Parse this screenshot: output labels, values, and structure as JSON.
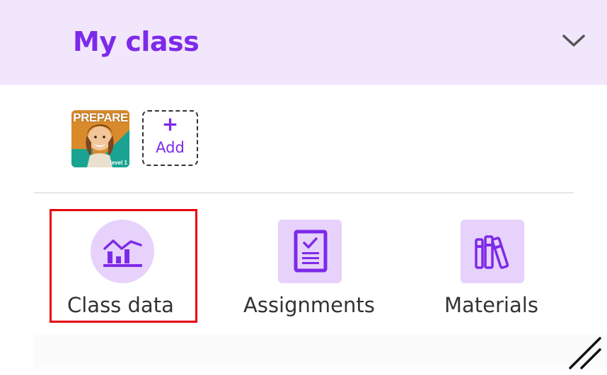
{
  "header": {
    "title": "My class",
    "toggle_icon": "chevron-down-icon"
  },
  "materials_row": {
    "book": {
      "brand": "PREPARE",
      "level": "level 1"
    },
    "add_tile": {
      "icon": "plus-icon",
      "label": "Add"
    }
  },
  "nav": {
    "items": [
      {
        "label": "Class data",
        "icon": "bar-chart-icon",
        "highlighted": true
      },
      {
        "label": "Assignments",
        "icon": "clipboard-check-icon",
        "highlighted": false
      },
      {
        "label": "Materials",
        "icon": "books-icon",
        "highlighted": false
      }
    ]
  },
  "colors": {
    "accent": "#7d2ae8",
    "header_bg": "#f2e6fd",
    "icon_bg": "#e6d2fb",
    "highlight": "#e8000b",
    "text": "#333333"
  }
}
